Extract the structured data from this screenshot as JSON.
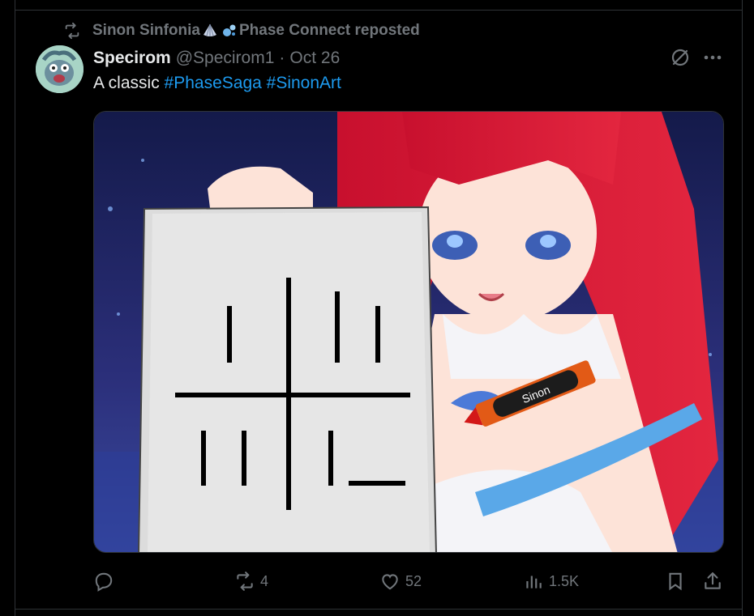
{
  "repost": {
    "text": "Sinon Sinfonia",
    "suffix": "Phase Connect reposted"
  },
  "tweet": {
    "name": "Specirom",
    "handle": "@Specirom1",
    "separator": "·",
    "date": "Oct 26",
    "text_plain": "A classic ",
    "hashtag1": "#PhaseSaga",
    "hashtag2": "#SinonArt"
  },
  "media": {
    "crayon_label": "Sinon"
  },
  "actions": {
    "reply_count": "",
    "repost_count": "4",
    "like_count": "52",
    "views_count": "1.5K"
  },
  "colors": {
    "background": "#000000",
    "text": "#e7e9ea",
    "muted": "#71767b",
    "link": "#1d9bf0",
    "border": "#2f3336"
  },
  "icons": [
    "repost-icon",
    "shell-emoji-icon",
    "bubbles-emoji-icon",
    "grok-icon",
    "more-icon",
    "reply-icon",
    "repost-action-icon",
    "like-icon",
    "views-icon",
    "bookmark-icon",
    "share-icon"
  ]
}
